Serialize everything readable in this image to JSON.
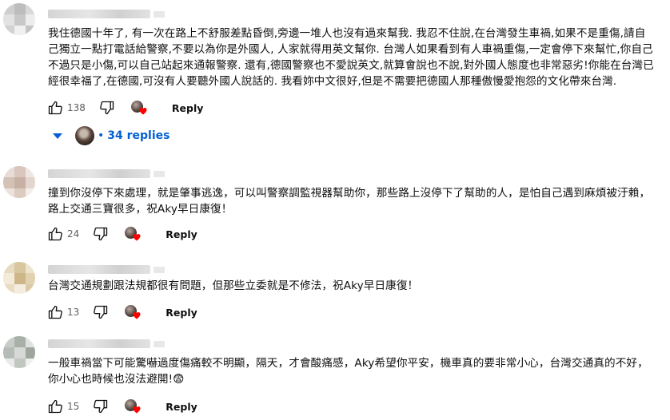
{
  "comments": [
    {
      "text": "我住德國十年了, 有一次在路上不舒服差點昏倒,旁邊一堆人也沒有過來幫我. 我忍不住說,在台灣發生車禍,如果不是重傷,請自己獨立一點打電話給警察,不要以為你是外國人, 人家就得用英文幫你. 台灣人如果看到有人車禍重傷,一定會停下來幫忙,你自己不過只是小傷,可以自己站起來通報警察. 還有,德國警察也不愛說英文,就算會說也不說,對外國人態度也非常惡劣!你能在台灣已經很幸福了,在德國,可沒有人要聽外國人說話的. 我看妳中文很好,但是不需要把德國人那種傲慢愛抱怨的文化帶來台灣.",
      "likes": "138",
      "reply_label": "Reply",
      "replies_label": "34 replies"
    },
    {
      "text": "撞到你沒停下來處理，就是肇事逃逸，可以叫警察調監視器幫助你，那些路上沒停下了幫助的人，是怕自己遇到麻煩被汙賴，路上交通三寶很多，祝Aky早日康復！",
      "likes": "24",
      "reply_label": "Reply"
    },
    {
      "text": "台灣交通規劃跟法規都很有問題，但那些立委就是不修法，祝Aky早日康復！",
      "likes": "13",
      "reply_label": "Reply"
    },
    {
      "text": "一般車禍當下可能驚嚇過度傷痛較不明顯，隔天，才會酸痛感，Aky希望你平安，機車真的要非常小心，台灣交通真的不好，你小心也時候也沒法避開!😨",
      "likes": "15",
      "reply_label": "Reply"
    }
  ],
  "icons": {
    "like": "thumbs-up-icon",
    "dislike": "thumbs-down-icon",
    "creator_heart": "creator-heart-icon",
    "expand": "chevron-down-icon"
  },
  "colors": {
    "link_blue": "#065fd4",
    "heart_red": "#ff0000",
    "muted_text": "#606060"
  }
}
